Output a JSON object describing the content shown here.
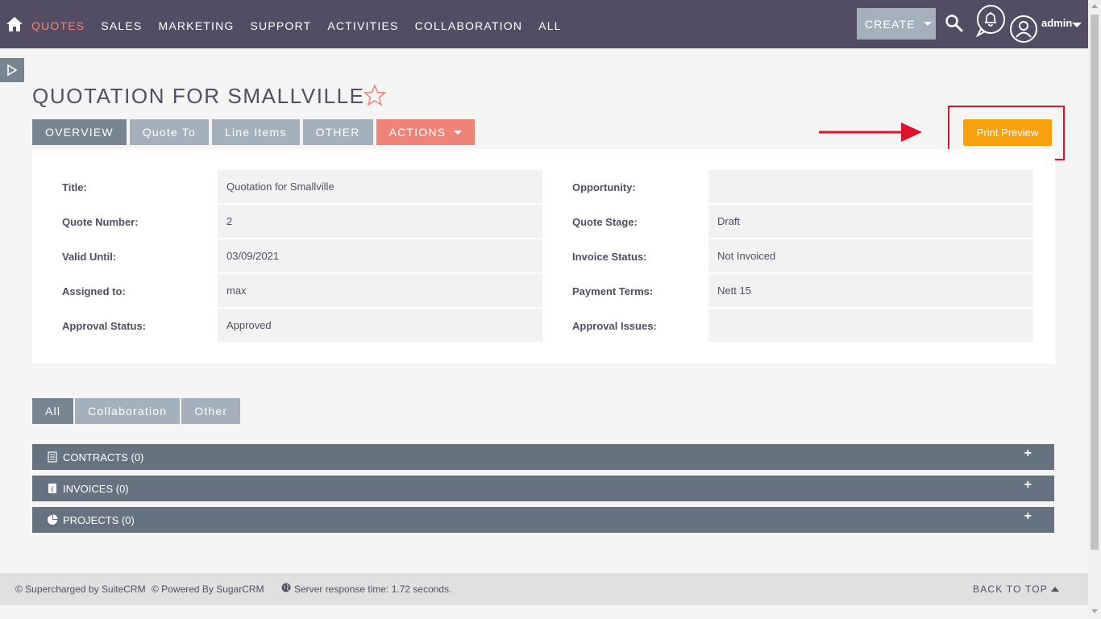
{
  "nav": {
    "items": [
      "QUOTES",
      "SALES",
      "MARKETING",
      "SUPPORT",
      "ACTIVITIES",
      "COLLABORATION",
      "ALL"
    ],
    "create_label": "CREATE",
    "user_label": "admin"
  },
  "page": {
    "title": "QUOTATION FOR SMALLVILLE"
  },
  "tabs": [
    "OVERVIEW",
    "Quote To",
    "Line Items",
    "OTHER",
    "ACTIONS"
  ],
  "print_preview_label": "Print Preview",
  "fields": {
    "left": [
      {
        "label": "Title:",
        "value": "Quotation for Smallville"
      },
      {
        "label": "Quote Number:",
        "value": "2"
      },
      {
        "label": "Valid Until:",
        "value": "03/09/2021"
      },
      {
        "label": "Assigned to:",
        "value": "max"
      },
      {
        "label": "Approval Status:",
        "value": "Approved"
      }
    ],
    "right": [
      {
        "label": "Opportunity:",
        "value": ""
      },
      {
        "label": "Quote Stage:",
        "value": "Draft"
      },
      {
        "label": "Invoice Status:",
        "value": "Not Invoiced"
      },
      {
        "label": "Payment Terms:",
        "value": "Nett 15"
      },
      {
        "label": "Approval Issues:",
        "value": ""
      }
    ]
  },
  "subtabs": [
    "All",
    "Collaboration",
    "Other"
  ],
  "subpanels": [
    "CONTRACTS (0)",
    "INVOICES (0)",
    "PROJECTS (0)"
  ],
  "footer": {
    "suitecrm": "© Supercharged by SuiteCRM",
    "sugarcrm": "© Powered By SugarCRM",
    "server_time": "Server response time: 1.72 seconds.",
    "back_to_top": "BACK TO TOP"
  },
  "colors": {
    "nav_bg": "#534d64",
    "accent": "#f08377",
    "print_button": "#f9a00e",
    "annotation": "#e0112b"
  }
}
